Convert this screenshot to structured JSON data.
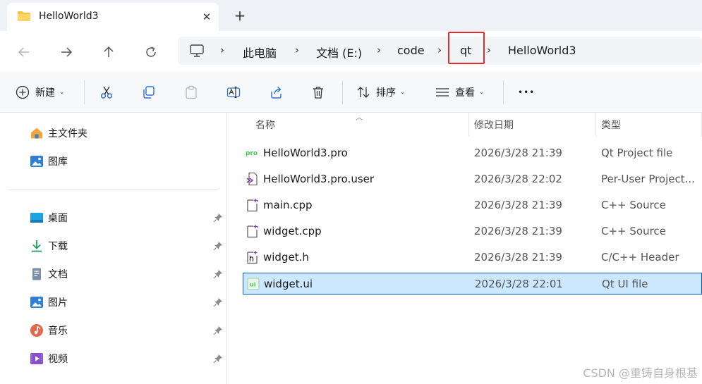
{
  "window": {
    "tab_title": "HelloWorld3",
    "close_glyph": "✕",
    "new_tab_glyph": "+"
  },
  "address_bar": {
    "crumbs": [
      "此电脑",
      "文档 (E:)",
      "code",
      "qt",
      "HelloWorld3"
    ],
    "separator_glyph": "›",
    "highlighted_crumb": "qt",
    "highlight_color": "#e52b2b"
  },
  "toolbar": {
    "new_label": "新建",
    "sort_label": "排序",
    "view_label": "查看",
    "more_glyph": "•••",
    "dropdown_glyph": "⌄"
  },
  "sidebar": {
    "items": [
      {
        "label": "主文件夹",
        "icon": "home-icon"
      },
      {
        "label": "图库",
        "icon": "gallery-icon"
      },
      {
        "label": "桌面",
        "icon": "desktop-icon",
        "pinned": true
      },
      {
        "label": "下载",
        "icon": "download-icon",
        "pinned": true
      },
      {
        "label": "文档",
        "icon": "documents-icon",
        "pinned": true
      },
      {
        "label": "图片",
        "icon": "pictures-icon",
        "pinned": true
      },
      {
        "label": "音乐",
        "icon": "music-icon",
        "pinned": true
      },
      {
        "label": "视频",
        "icon": "video-icon",
        "pinned": true
      }
    ]
  },
  "file_list": {
    "columns": {
      "name": "名称",
      "date": "修改日期",
      "type": "类型"
    },
    "rows": [
      {
        "name": "HelloWorld3.pro",
        "date": "2026/3/28 21:39",
        "type": "Qt Project file",
        "icon": "qt-pro-file-icon",
        "selected": false
      },
      {
        "name": "HelloWorld3.pro.user",
        "date": "2026/3/28 22:02",
        "type": "Per-User Project...",
        "icon": "qt-user-file-icon",
        "selected": false
      },
      {
        "name": "main.cpp",
        "date": "2026/3/28 21:39",
        "type": "C++ Source",
        "icon": "cpp-file-icon",
        "selected": false
      },
      {
        "name": "widget.cpp",
        "date": "2026/3/28 21:39",
        "type": "C++ Source",
        "icon": "cpp-file-icon",
        "selected": false
      },
      {
        "name": "widget.h",
        "date": "2026/3/28 21:39",
        "type": "C/C++ Header",
        "icon": "header-file-icon",
        "selected": false
      },
      {
        "name": "widget.ui",
        "date": "2026/3/28 22:01",
        "type": "Qt UI file",
        "icon": "qt-ui-file-icon",
        "selected": true
      }
    ],
    "selection_color": "#cce8ff"
  },
  "watermark": "CSDN @重铸自身根基"
}
